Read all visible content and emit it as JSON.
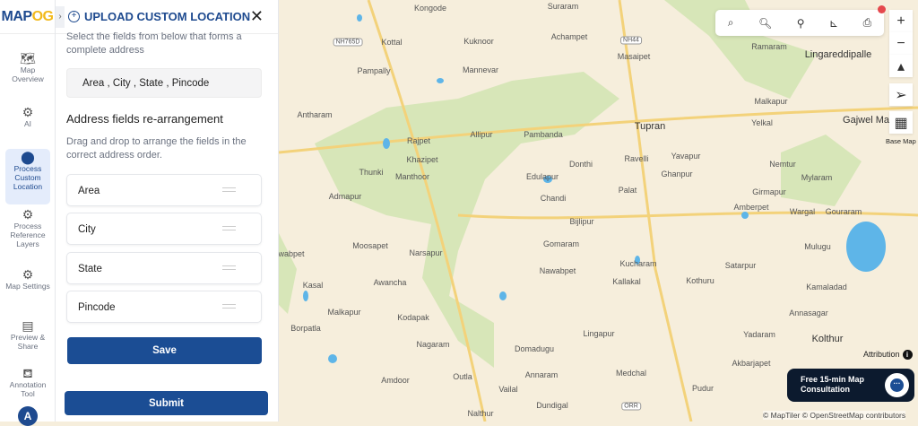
{
  "app": {
    "logo": "MAPOG"
  },
  "rail": {
    "items": [
      {
        "label": "Map Overview",
        "icon": "map-icon"
      },
      {
        "label": "AI",
        "icon": "gear-icon"
      },
      {
        "label": "Process Custom Location",
        "icon": "location-pin-icon",
        "active": true
      },
      {
        "label": "Process Reference Layers",
        "icon": "gear-icon"
      },
      {
        "label": "Map Settings",
        "icon": "gear-icon"
      },
      {
        "label": "Preview & Share",
        "icon": "preview-icon"
      },
      {
        "label": "Annotation Tool",
        "icon": "paint-bucket-icon"
      }
    ],
    "avatar": "A"
  },
  "panel": {
    "title": "UPLOAD CUSTOM LOCATION",
    "select_hint": "Select the fields from below that forms a complete address",
    "selected_fields": "Area , City , State , Pincode",
    "rearrange_heading": "Address fields re-arrangement",
    "rearrange_hint": "Drag and drop to arrange the fields in the correct address order.",
    "fields": [
      "Area",
      "City",
      "State",
      "Pincode"
    ],
    "save_label": "Save",
    "submit_label": "Submit"
  },
  "map": {
    "labels": [
      "Kongode",
      "Suraram",
      "Kuknoor",
      "Achampet",
      "Kottal",
      "NH765D",
      "NH44",
      "Masaipet",
      "Ramaram",
      "Lingareddipalle",
      "Pampally",
      "Mannevar",
      "Malkapur",
      "Antharam",
      "Yelkal",
      "Gajwel Ma",
      "Allipur",
      "Pambanda",
      "Tupran",
      "Rajpet",
      "Khazipet",
      "Donthi",
      "Ravelli",
      "Yavapur",
      "Nemtur",
      "Thunki",
      "Manthoor",
      "Edulapur",
      "Ghanpur",
      "Mylaram",
      "Chandi",
      "Palat",
      "Girmapur",
      "Admapur",
      "Amberpet",
      "Wargal",
      "Gouraram",
      "Bijlipur",
      "Moosapet",
      "Narsapur",
      "Gomaram",
      "Mulugu",
      "Nawabpet",
      "Kucharam",
      "Satarpur",
      "wabpet",
      "Awancha",
      "Kallakal",
      "Kothuru",
      "Kamaladad",
      "Kasal",
      "Malkapur",
      "Kodapak",
      "Annasagar",
      "Borpatla",
      "Lingapur",
      "Yadaram",
      "Kolthur",
      "Nagaram",
      "Domadugu",
      "Akbarjapet",
      "Amdoor",
      "Outla",
      "Annaram",
      "Medchal",
      "Pudur",
      "Vailal",
      "Dundigal",
      "ORR",
      "Nalthur"
    ],
    "base_map_label": "Base Map",
    "attribution_label": "Attribution",
    "consultation_label": "Free 15-min Map Consultation",
    "credit": "© MapTiler © OpenStreetMap contributors",
    "colors": {
      "land": "#f6eedc",
      "forest": "#d7e6b8",
      "water": "#5eb5e8",
      "road": "#f3d27a"
    }
  }
}
